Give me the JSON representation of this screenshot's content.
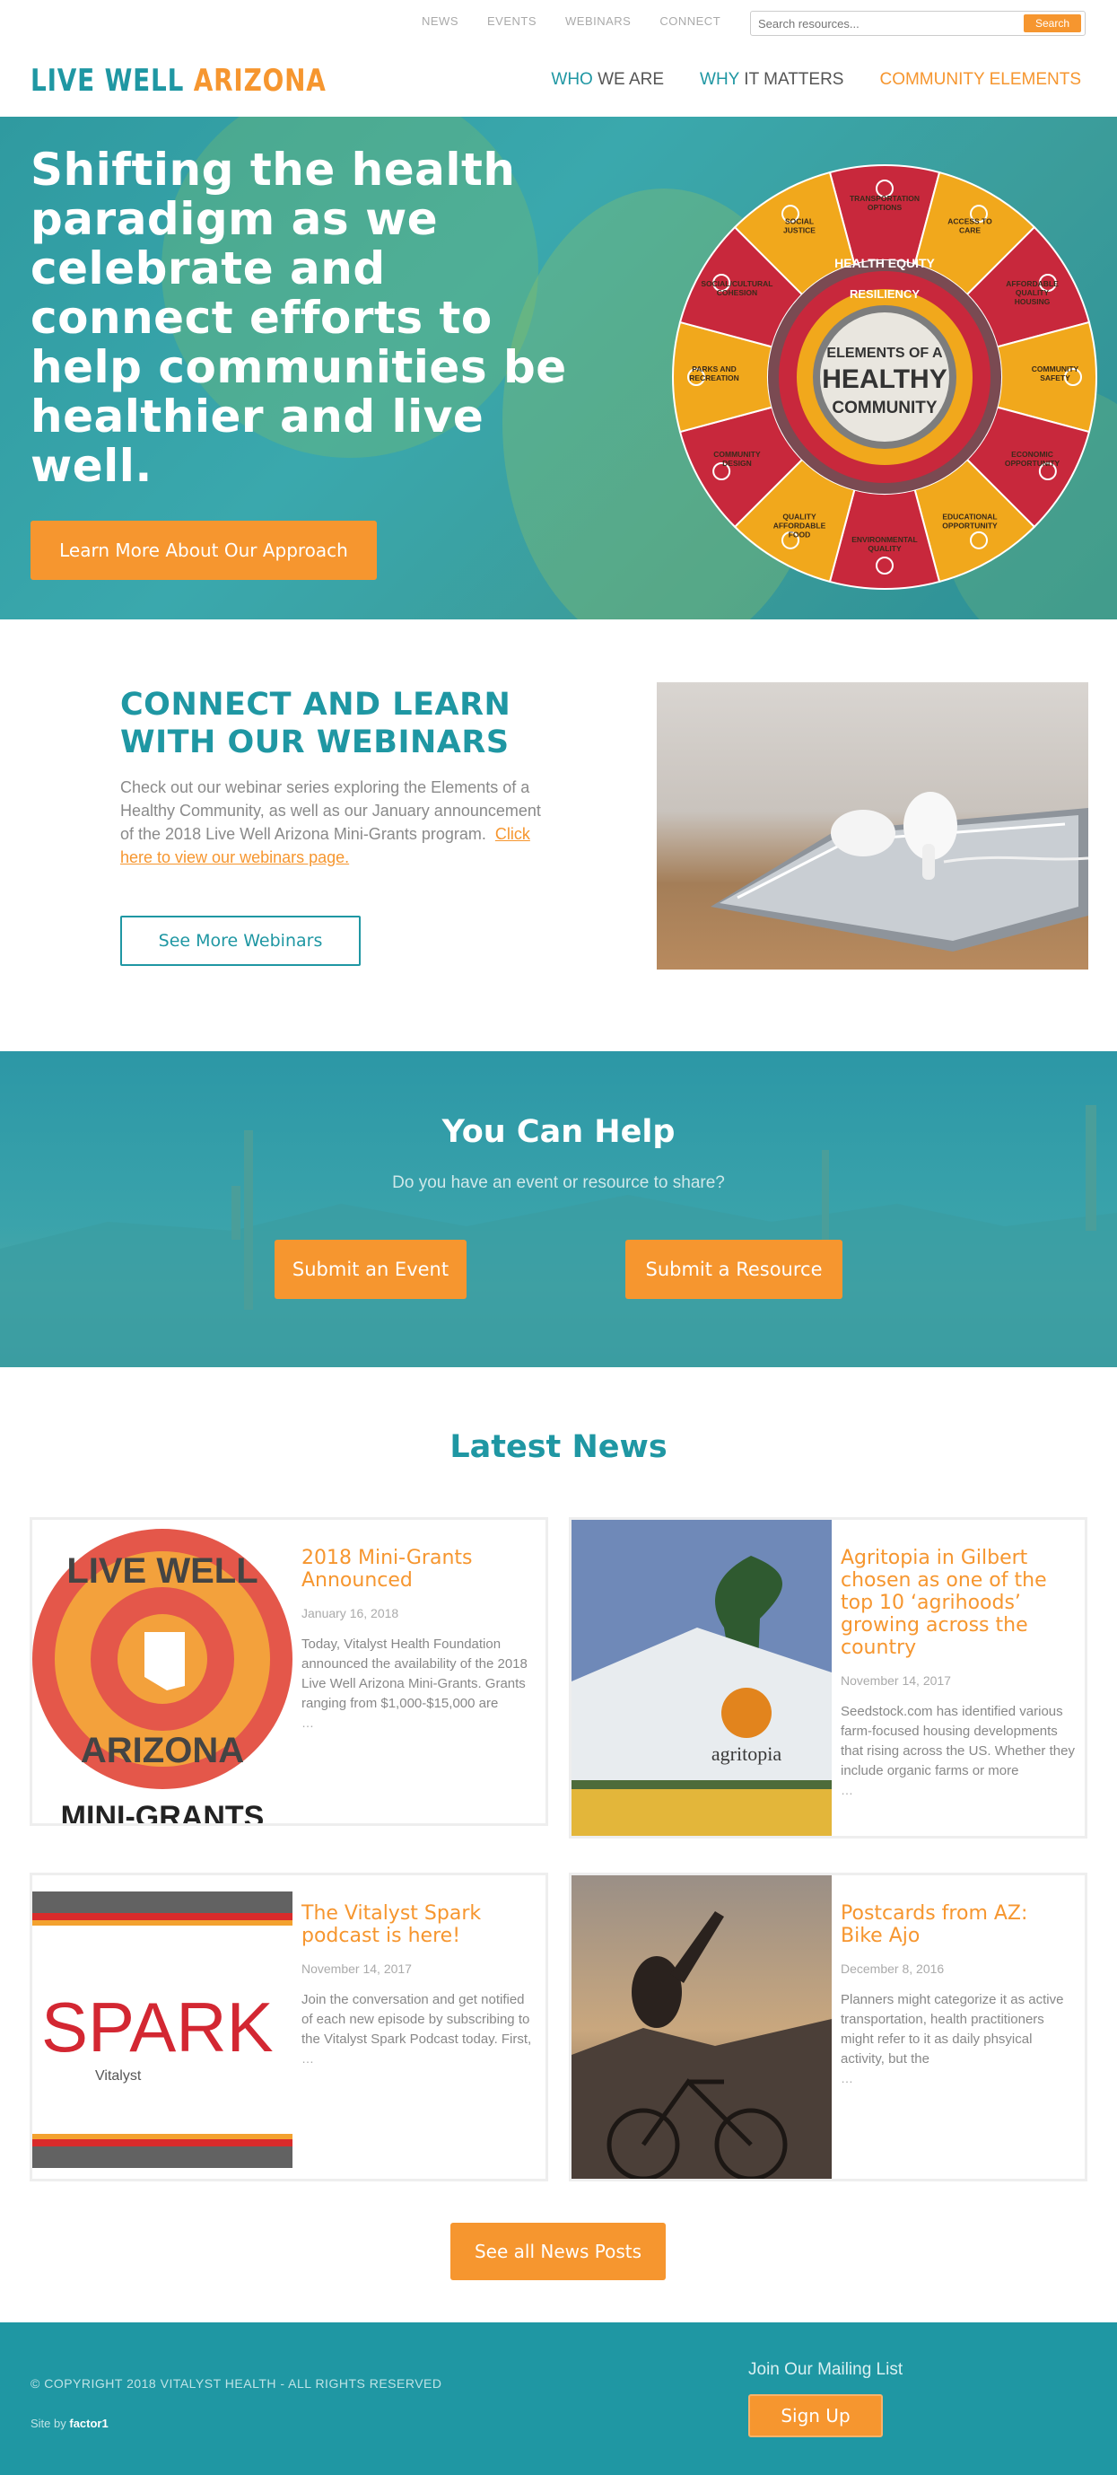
{
  "utility": {
    "links": [
      "NEWS",
      "EVENTS",
      "WEBINARS",
      "CONNECT"
    ],
    "search_placeholder": "Search resources...",
    "search_button": "Search"
  },
  "brand": {
    "part1": "LIVE WELL",
    "part2": "ARIZONA"
  },
  "nav": {
    "who_accent": "WHO",
    "who_rest": " WE ARE",
    "why_accent": "WHY",
    "why_rest": " IT MATTERS",
    "community": "COMMUNITY ELEMENTS"
  },
  "hero": {
    "title": "Shifting the health paradigm as we celebrate and connect efforts to help communities be healthier and live well.",
    "button": "Learn More About Our Approach"
  },
  "wheel": {
    "center_line1": "ELEMENTS OF A",
    "center_line2": "HEALTHY",
    "center_line3": "COMMUNITY",
    "ring_line1": "HEALTH EQUITY",
    "ring_line2": "RESILIENCY",
    "segments": [
      "TRANSPORTATION OPTIONS",
      "ACCESS TO CARE",
      "AFFORDABLE QUALITY HOUSING",
      "COMMUNITY SAFETY",
      "ECONOMIC OPPORTUNITY",
      "EDUCATIONAL OPPORTUNITY",
      "ENVIRONMENTAL QUALITY",
      "QUALITY AFFORDABLE FOOD",
      "COMMUNITY DESIGN",
      "PARKS AND RECREATION",
      "SOCIAL/CULTURAL COHESION",
      "SOCIAL JUSTICE"
    ]
  },
  "webinars": {
    "title": "CONNECT AND LEARN WITH OUR WEBINARS",
    "text": "Check out our webinar series exploring the Elements of a Healthy Community, as well as our January announcement of the 2018 Live Well Arizona Mini-Grants program.",
    "link": "Click here to view our webinars page.",
    "button": "See More Webinars"
  },
  "help": {
    "title": "You Can Help",
    "subtitle": "Do you have an event or resource to share?",
    "event_button": "Submit an Event",
    "resource_button": "Submit a Resource"
  },
  "news": {
    "title": "Latest News",
    "cards": [
      {
        "title": "2018 Mini-Grants Announced",
        "date": "January 16, 2018",
        "excerpt": "Today, Vitalyst Health Foundation announced the availability of the 2018 Live Well Arizona Mini-Grants. Grants ranging from $1,000-$15,000 are",
        "more": "…",
        "thumb_top": "LIVE WELL",
        "thumb_bottom": "ARIZONA",
        "thumb_caption": "MINI-GRANTS"
      },
      {
        "title": "Agritopia in Gilbert chosen as one of the top 10 ‘agrihoods’ growing across the country",
        "date": "November 14, 2017",
        "excerpt": "Seedstock.com has identified various farm-focused housing developments that rising across the US. Whether they include organic farms or more",
        "more": "…",
        "thumb_sign": "agritopia"
      },
      {
        "title": "The Vitalyst Spark podcast is here!",
        "date": "November 14, 2017",
        "excerpt": "Join the conversation and get notified of each new episode by subscribing to the Vitalyst Spark Podcast today. First,",
        "more": "…",
        "thumb_word": "SPARK",
        "thumb_brand": "Vitalyst"
      },
      {
        "title": "Postcards from AZ: Bike Ajo",
        "date": "December 8, 2016",
        "excerpt": "Planners might categorize it as active transportation, health practitioners might refer to it as daily phsyical activity, but the",
        "more": "…"
      }
    ],
    "all_button": "See all News Posts"
  },
  "footer": {
    "copyright": "© COPYRIGHT 2018 VITALYST HEALTH - ALL RIGHTS RESERVED",
    "site_by_label": "Site by",
    "site_by_name": "factor1",
    "mailing_title": "Join Our Mailing List",
    "signup": "Sign Up"
  },
  "colors": {
    "teal": "#1f97a3",
    "orange": "#f6962f",
    "wheel_red": "#c8283c",
    "wheel_yellow": "#f1a81c"
  }
}
